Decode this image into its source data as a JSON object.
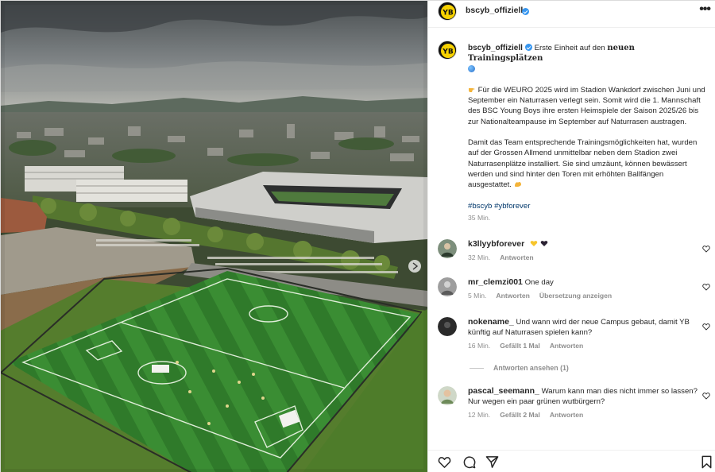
{
  "post": {
    "username": "bscyb_offiziell",
    "more_icon": "more-horizontal-icon"
  },
  "caption": {
    "username": "bscyb_offiziell",
    "lead": "Erste Einheit auf den",
    "lead_bold": "neuen Trainingsplätzen",
    "globe_icon": "globe-emoji",
    "para1_emoji": "pointing-hand-emoji",
    "para1": "Für die WEURO 2025 wird im Stadion Wankdorf zwischen Juni und September ein Naturrasen verlegt sein. Somit wird die 1. Mannschaft des BSC Young Boys ihre ersten Heimspiele der Saison 2025/26 bis zur Nationalteampause im September auf Naturrasen austragen.",
    "para2": "Damit das Team entsprechende Trainingsmöglichkeiten hat, wurden auf der Grossen Allmend unmittelbar neben dem Stadion zwei Naturrasenplätze installiert. Sie sind umzäunt, können bewässert werden und sind hinter den Toren mit erhöhten Ballfängen ausgestattet.",
    "para2_emoji": "flexed-biceps-emoji",
    "hashtags": "#bscyb #ybforever",
    "time": "35 Min."
  },
  "comments": [
    {
      "username": "k3llyybforever",
      "text": "",
      "emojis": [
        "yellow-heart-emoji",
        "black-heart-emoji"
      ],
      "time": "32 Min.",
      "actions": [
        "Antworten"
      ]
    },
    {
      "username": "mr_clemzi001",
      "text": "One day",
      "time": "5 Min.",
      "actions": [
        "Antworten",
        "Übersetzung anzeigen"
      ]
    },
    {
      "username": "nokename_",
      "text": "Und wann wird der neue Campus gebaut, damit YB künftig auf Naturrasen spielen kann?",
      "time": "16 Min.",
      "actions": [
        "Gefällt 1 Mal",
        "Antworten"
      ]
    },
    {
      "username": "pascal_seemann_",
      "text": "Warum kann man dies nicht immer so lassen? Nur wegen ein paar grünen wutbürgern?",
      "time": "12 Min.",
      "actions": [
        "Gefällt 2 Mal",
        "Antworten"
      ]
    }
  ],
  "view_replies": "Antworten ansehen (1)",
  "action_bar": {
    "icons": [
      "heart-outline-icon",
      "comment-icon",
      "share-icon",
      "bookmark-icon"
    ]
  },
  "colors": {
    "link": "#00376b",
    "verified": "#3897f0",
    "muted": "#8e8e8e",
    "yb_yellow": "#f7d200"
  }
}
